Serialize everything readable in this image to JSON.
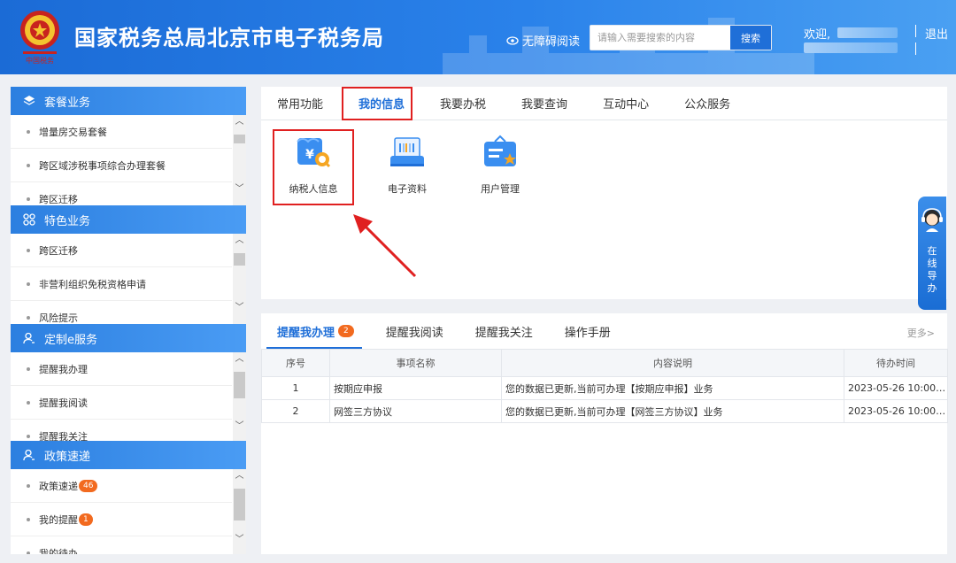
{
  "header": {
    "site_title": "国家税务总局北京市电子税务局",
    "accessibility": "无障碍阅读",
    "search_placeholder": "请输入需要搜索的内容",
    "search_button": "搜索",
    "welcome": "欢迎,",
    "logout": "退出"
  },
  "sidebar": {
    "sections": [
      {
        "title": "套餐业务",
        "icon": "layers-icon",
        "items": [
          "增量房交易套餐",
          "跨区域涉税事项综合办理套餐",
          "跨区迁移"
        ]
      },
      {
        "title": "特色业务",
        "icon": "grid-icon",
        "items": [
          "跨区迁移",
          "非营利组织免税资格申请",
          "风险提示"
        ]
      },
      {
        "title": "定制e服务",
        "icon": "user-icon",
        "items": [
          "提醒我办理",
          "提醒我阅读",
          "提醒我关注"
        ]
      },
      {
        "title": "政策速递",
        "icon": "user-icon",
        "items": [
          "政策速递",
          "我的提醒",
          "我的待办"
        ],
        "badges": [
          "46",
          "1",
          ""
        ]
      }
    ]
  },
  "main_tabs": [
    "常用功能",
    "我的信息",
    "我要办税",
    "我要查询",
    "互动中心",
    "公众服务"
  ],
  "active_tab": "我的信息",
  "apps": [
    {
      "label": "纳税人信息",
      "icon": "taxpayer-info-icon"
    },
    {
      "label": "电子资料",
      "icon": "electronic-docs-icon"
    },
    {
      "label": "用户管理",
      "icon": "user-management-icon"
    }
  ],
  "reminders": {
    "tabs": [
      {
        "label": "提醒我办理",
        "count": "2"
      },
      {
        "label": "提醒我阅读",
        "count": ""
      },
      {
        "label": "提醒我关注",
        "count": ""
      },
      {
        "label": "操作手册",
        "count": ""
      }
    ],
    "more": "更多>",
    "columns": [
      "序号",
      "事项名称",
      "内容说明",
      "待办时间"
    ],
    "rows": [
      [
        "1",
        "按期应申报",
        "您的数据已更新,当前可办理【按期应申报】业务",
        "2023-05-26 10:00:..."
      ],
      [
        "2",
        "网签三方协议",
        "您的数据已更新,当前可办理【网签三方协议】业务",
        "2023-05-26 10:00:..."
      ]
    ]
  },
  "help": {
    "label": "在线导办"
  },
  "colors": {
    "primary": "#1f6fd8",
    "highlight": "#e02020",
    "badge": "#f26a1f"
  }
}
